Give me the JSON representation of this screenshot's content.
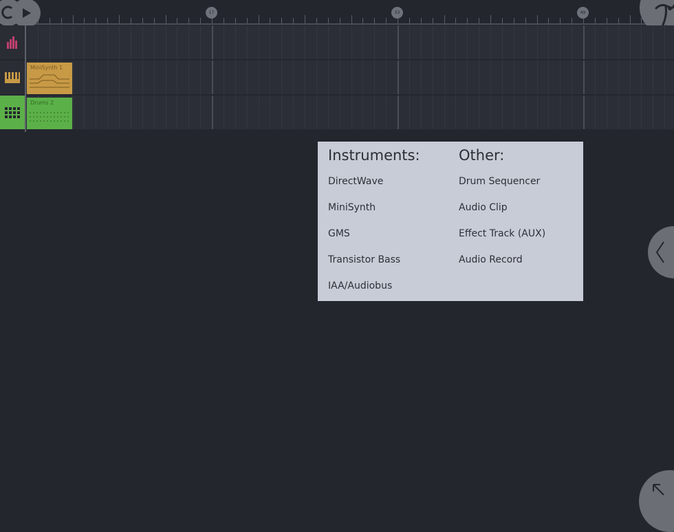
{
  "timeline": {
    "bar_markers": [
      "17",
      "33",
      "49"
    ]
  },
  "tracks": [
    {
      "clip_name": "MiniSynth 1"
    },
    {
      "clip_name": "Drums 2"
    }
  ],
  "menu": {
    "instruments_heading": "Instruments:",
    "other_heading": "Other:",
    "instruments": [
      "DirectWave",
      "MiniSynth",
      "GMS",
      "Transistor Bass",
      "IAA/Audiobus"
    ],
    "other": [
      "Drum Sequencer",
      "Audio Clip",
      "Effect Track (AUX)",
      "Audio Record"
    ]
  },
  "icons": {
    "loop": "loop-icon",
    "play": "play-icon",
    "app_logo": "app-logo-icon",
    "mixer": "mixer-icon",
    "piano": "piano-icon",
    "drum_pads": "drum-pads-icon",
    "collapse_panel": "chevron-left-icon",
    "expand": "expand-arrow-icon"
  },
  "colors": {
    "background": "#23262d",
    "menu_background": "#c8ccd6",
    "synth_clip": "#c89a46",
    "drum_clip": "#5cb048",
    "mixer_accent": "#c0406e"
  }
}
